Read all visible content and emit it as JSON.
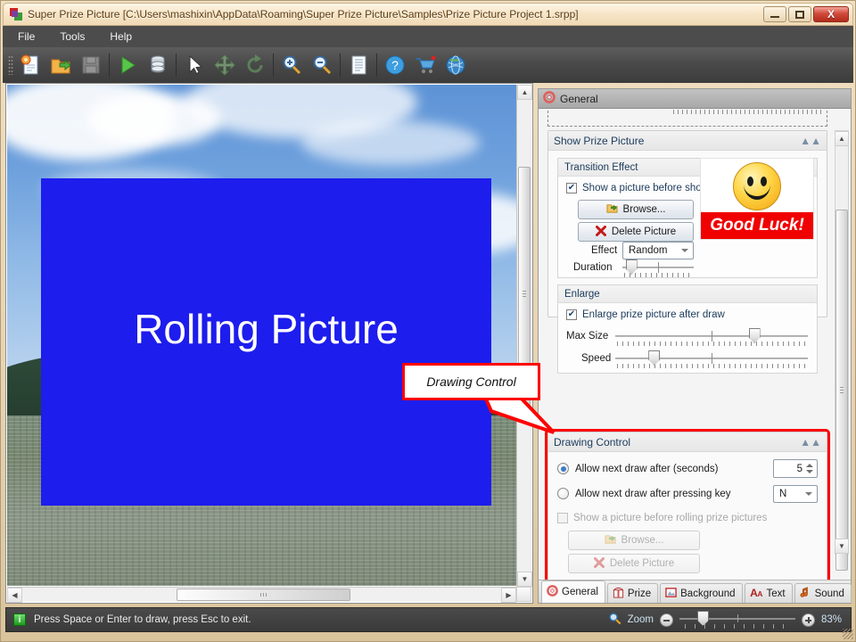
{
  "window": {
    "title": "Super Prize Picture [C:\\Users\\mashixin\\AppData\\Roaming\\Super Prize Picture\\Samples\\Prize Picture Project 1.srpp]",
    "minimize_label": "Minimize",
    "maximize_label": "Maximize",
    "close_label": "X"
  },
  "menubar": {
    "items": [
      {
        "label": "File"
      },
      {
        "label": "Tools"
      },
      {
        "label": "Help"
      }
    ]
  },
  "toolbar": {
    "buttons": [
      {
        "name": "new-project-icon",
        "tip": "New"
      },
      {
        "name": "open-project-icon",
        "tip": "Open"
      },
      {
        "name": "save-project-icon",
        "tip": "Save",
        "disabled": true
      },
      {
        "name": "run-play-icon",
        "tip": "Run"
      },
      {
        "name": "database-icon",
        "tip": "Database"
      },
      {
        "name": "pointer-select-icon",
        "tip": "Select"
      },
      {
        "name": "move-icon",
        "tip": "Move",
        "disabled": true
      },
      {
        "name": "rotate-icon",
        "tip": "Rotate",
        "disabled": true
      },
      {
        "name": "zoom-in-icon",
        "tip": "Zoom In"
      },
      {
        "name": "zoom-out-icon",
        "tip": "Zoom Out"
      },
      {
        "name": "document-icon",
        "tip": "Report"
      },
      {
        "name": "help-icon",
        "tip": "Help"
      },
      {
        "name": "cart-icon",
        "tip": "Buy"
      },
      {
        "name": "globe-icon",
        "tip": "Website"
      }
    ]
  },
  "canvas": {
    "rolling_picture_label": "Rolling Picture"
  },
  "callout": {
    "text": "Drawing Control"
  },
  "panel": {
    "header_title": "General",
    "show_prize_picture": {
      "title": "Show Prize Picture",
      "transition_effect": {
        "title": "Transition Effect",
        "show_picture_checkbox": "Show a picture before showing prize picture",
        "show_picture_checked": true,
        "browse_label": "Browse...",
        "delete_picture_label": "Delete Picture",
        "effect_label": "Effect",
        "effect_value": "Random",
        "duration_label": "Duration",
        "duration_percent": 12,
        "preview_banner": "Good Luck!"
      },
      "enlarge": {
        "title": "Enlarge",
        "enlarge_checkbox": "Enlarge prize picture after draw",
        "enlarge_checked": true,
        "max_size_label": "Max Size",
        "max_size_percent": 72,
        "speed_label": "Speed",
        "speed_percent": 20
      }
    },
    "drawing_control": {
      "title": "Drawing Control",
      "radio_seconds_label": "Allow next draw after (seconds)",
      "radio_seconds_selected": true,
      "seconds_value": "5",
      "radio_key_label": "Allow next draw after pressing key",
      "radio_key_selected": false,
      "key_value": "N",
      "show_picture_checkbox": "Show a picture before rolling prize pictures",
      "show_picture_checked": false,
      "browse_label": "Browse...",
      "delete_picture_label": "Delete Picture"
    },
    "tabs": [
      {
        "label": "General",
        "icon": "gear-icon",
        "active": true
      },
      {
        "label": "Prize",
        "icon": "gift-icon",
        "active": false
      },
      {
        "label": "Background",
        "icon": "image-icon",
        "active": false
      },
      {
        "label": "Text",
        "icon": "font-icon",
        "active": false
      },
      {
        "label": "Sound",
        "icon": "note-icon",
        "active": false
      }
    ]
  },
  "statusbar": {
    "info_glyph": "i",
    "message": "Press Space or Enter to draw, press Esc to exit.",
    "zoom_label": "Zoom",
    "zoom_value": "83%",
    "zoom_percent": 20,
    "zoom_out_label": "Zoom out",
    "zoom_in_label": "Zoom in"
  },
  "colors": {
    "accent_red": "#ff0000",
    "blue_box": "#1d1dee",
    "banner_red": "#f00000",
    "titlebar": "#f6e4c6"
  }
}
